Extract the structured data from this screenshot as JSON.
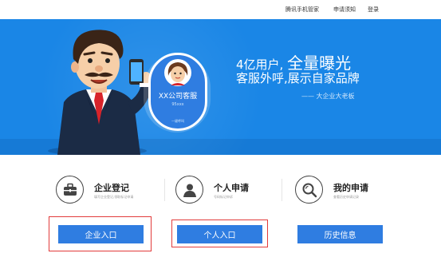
{
  "topnav": {
    "links": [
      "腾讯手机管家",
      "申请须知",
      "登录"
    ]
  },
  "banner": {
    "phone_card": {
      "name": "XX公司客服",
      "number": "95xxx",
      "footer": "一键呼叫"
    },
    "tagline": {
      "line1_pre": "4亿用户,",
      "line1_accent": "全量曝光",
      "line2": "客服外呼,展示自家品牌",
      "line3": "—— 大企业大老板"
    }
  },
  "cards": [
    {
      "title": "企业登记",
      "desc": "填写企业登记,领取标记申请",
      "icon": "briefcase-icon"
    },
    {
      "title": "个人申请",
      "desc": "号码标记申诉",
      "icon": "person-icon"
    },
    {
      "title": "我的申请",
      "desc": "查看历史申请记录",
      "icon": "search-doc-icon"
    }
  ],
  "buttons": {
    "enterprise": "企业入口",
    "personal": "个人入口",
    "history": "历史信息"
  },
  "colors": {
    "banner_blue": "#1a86e6",
    "button_blue": "#2f7de1",
    "highlight_red": "#e23b3b"
  }
}
